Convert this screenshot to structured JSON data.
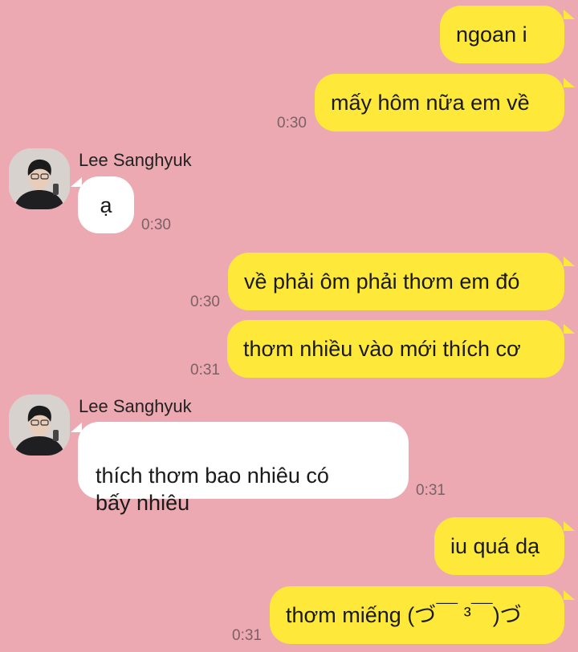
{
  "contact": {
    "name": "Lee Sanghyuk",
    "avatar_icon": "profile-photo"
  },
  "colors": {
    "background": "#eca9b2",
    "outgoing_bubble": "#fee83a",
    "incoming_bubble": "#ffffff"
  },
  "messages": [
    {
      "sender": "me",
      "text": "ngoan i",
      "time": ""
    },
    {
      "sender": "me",
      "text": "mấy hôm nữa em về",
      "time": "0:30"
    },
    {
      "sender": "them",
      "text": "ạ",
      "time": "0:30"
    },
    {
      "sender": "me",
      "text": "về phải ôm phải thơm em đó",
      "time": "0:30"
    },
    {
      "sender": "me",
      "text": "thơm nhiều vào mới thích cơ",
      "time": "0:31"
    },
    {
      "sender": "them",
      "text": "thích thơm bao nhiêu có\nbấy nhiêu",
      "time": "0:31"
    },
    {
      "sender": "me",
      "text": "iu quá dạ",
      "time": ""
    },
    {
      "sender": "me",
      "text": "thơm miếng (づ￣ ³￣)づ",
      "time": "0:31"
    }
  ]
}
